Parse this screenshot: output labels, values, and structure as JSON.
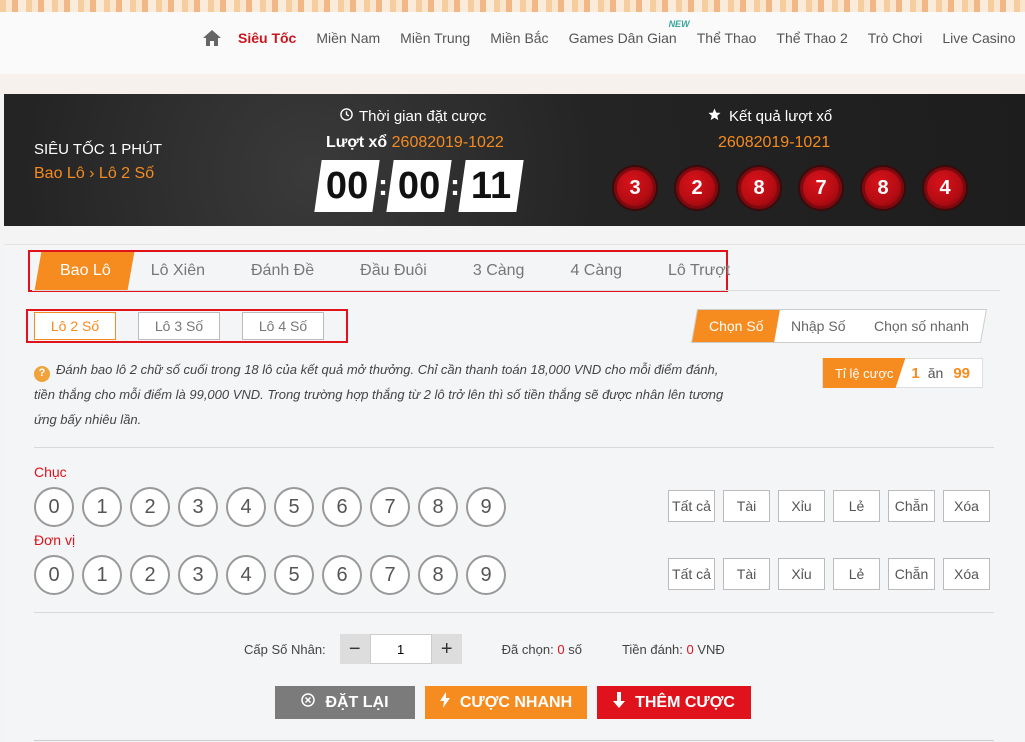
{
  "nav": {
    "items": [
      "Siêu Tốc",
      "Miền Nam",
      "Miền Trung",
      "Miền Bắc",
      "Games Dân Gian",
      "Thể Thao",
      "Thể Thao 2",
      "Trò Chơi",
      "Live Casino"
    ],
    "new_badge": "NEW"
  },
  "banner": {
    "title": "SIÊU TỐC 1 PHÚT",
    "crumb": "Bao Lô › Lô 2 Số",
    "timer_label": "Thời gian đặt cược",
    "draw_label": "Lượt xổ",
    "draw_id": "26082019-1022",
    "timer": [
      "00",
      "00",
      "11"
    ],
    "result_label": "Kết quả lượt xổ",
    "result_id": "26082019-1021",
    "result_balls": [
      "3",
      "2",
      "8",
      "7",
      "8",
      "4"
    ]
  },
  "tabs": [
    "Bao Lô",
    "Lô Xiên",
    "Đánh Đề",
    "Đầu Đuôi",
    "3 Càng",
    "4 Càng",
    "Lô Trượt"
  ],
  "subtabs": [
    "Lô 2 Số",
    "Lô 3 Số",
    "Lô 4 Số"
  ],
  "modes": [
    "Chọn Số",
    "Nhập Số",
    "Chọn số nhanh"
  ],
  "description": "Đánh bao lô 2 chữ số cuối trong 18 lô của kết quả mở thưởng. Chỉ cần thanh toán 18,000 VND cho mỗi điểm đánh, tiền thắng cho mỗi điểm là 99,000 VND. Trong trường hợp thắng từ 2 lô trở lên thì số tiền thắng sẽ được nhân lên tương ứng bấy nhiêu lần.",
  "ratio": {
    "label": "Tỉ lệ cược",
    "left": "1",
    "word": "ăn",
    "right": "99"
  },
  "rows": [
    {
      "label": "Chục",
      "numbers": [
        "0",
        "1",
        "2",
        "3",
        "4",
        "5",
        "6",
        "7",
        "8",
        "9"
      ]
    },
    {
      "label": "Đơn vị",
      "numbers": [
        "0",
        "1",
        "2",
        "3",
        "4",
        "5",
        "6",
        "7",
        "8",
        "9"
      ]
    }
  ],
  "quick": [
    "Tất cả",
    "Tài",
    "Xỉu",
    "Lẻ",
    "Chẵn",
    "Xóa"
  ],
  "multiplier": {
    "label": "Cấp Số Nhân:",
    "value": "1"
  },
  "chosen": {
    "label": "Đã chọn:",
    "value": "0",
    "unit": "số"
  },
  "stake": {
    "label": "Tiền đánh:",
    "value": "0",
    "unit": "VNĐ"
  },
  "actions": {
    "reset": "ĐẶT LẠI",
    "fast": "CƯỢC NHANH",
    "add": "THÊM CƯỢC"
  },
  "colors": {
    "accent": "#f68b1f",
    "red": "#e0121b",
    "banner": "#222222"
  }
}
